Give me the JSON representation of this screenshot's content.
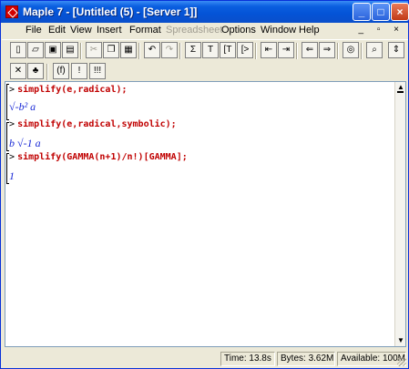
{
  "window": {
    "title": "Maple 7 - [Untitled (5) - [Server 1]]",
    "min_label": "_",
    "max_label": "□",
    "close_label": "×"
  },
  "menu": {
    "items": [
      "File",
      "Edit",
      "View",
      "Insert",
      "Format",
      "Spreadsheet",
      "Options",
      "Window",
      "Help"
    ],
    "disabled": [
      "Spreadsheet"
    ],
    "mdi_controls": "_ ▫ ×"
  },
  "toolbar": {
    "sigma": "Σ",
    "text_T": "T",
    "math_T": "[T",
    "prompt_gt": "[>",
    "exec_label": "!",
    "exec_all_label": "!!!",
    "func_label": "(f)"
  },
  "worksheet": {
    "lines": [
      {
        "type": "input",
        "prompt": ">",
        "text": "simplify(e,radical);"
      },
      {
        "type": "output",
        "text": "√-b² a"
      },
      {
        "type": "input",
        "prompt": ">",
        "text": "simplify(e,radical,symbolic);"
      },
      {
        "type": "output",
        "text": "b √-1 a"
      },
      {
        "type": "input",
        "prompt": ">",
        "text": "simplify(GAMMA(n+1)/n!)[GAMMA];"
      },
      {
        "type": "output",
        "text": "1"
      }
    ]
  },
  "status": {
    "time": "Time: 13.8s",
    "bytes": "Bytes: 3.62M",
    "available": "Available: 100M"
  },
  "colors": {
    "input_red": "#c00000",
    "output_blue": "#1a2ad6",
    "titlebar_blue": "#0453d6"
  }
}
